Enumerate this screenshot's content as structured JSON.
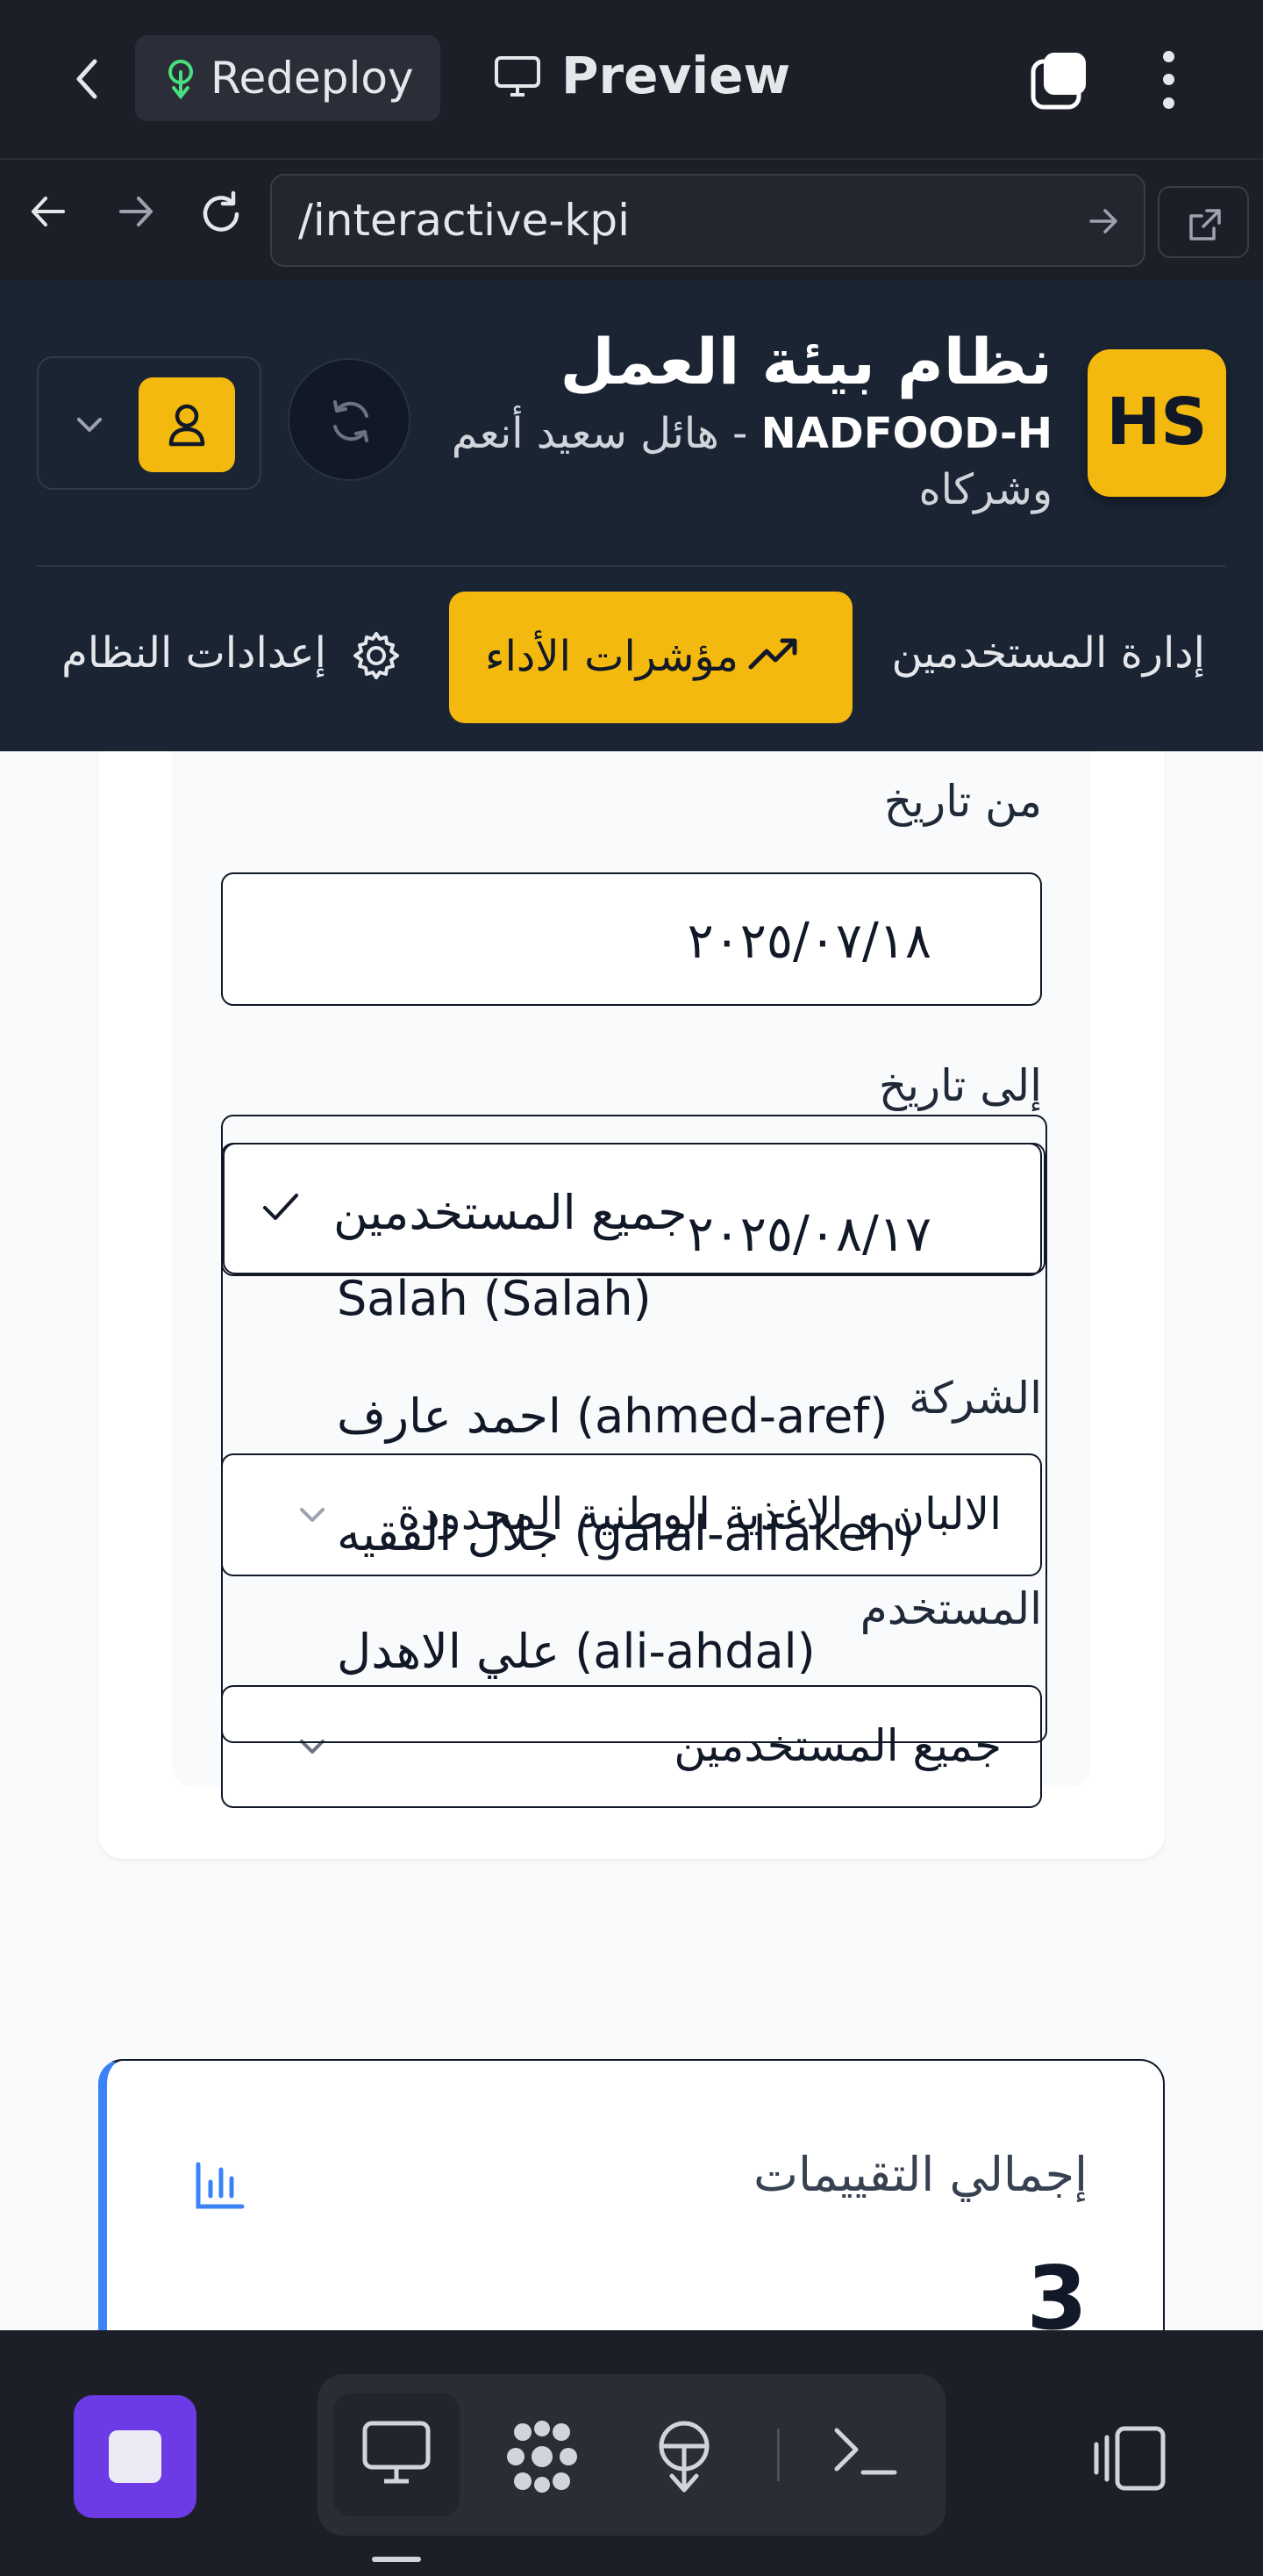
{
  "toolbar": {
    "redeploy_label": "Redeploy",
    "preview_label": "Preview"
  },
  "browser": {
    "url": "/interactive-kpi"
  },
  "app_header": {
    "logo_text": "HS",
    "title": "نظام بيئة العمل",
    "company_code": "NADFOOD-H",
    "company_name_line1": " - هائل سعيد أنعم",
    "company_name_line2": "وشركاه"
  },
  "nav": {
    "users": "إدارة المستخدمين",
    "kpi": "مؤشرات الأداء",
    "settings": "إعدادات النظام"
  },
  "filters": {
    "from_date_label": "من تاريخ",
    "from_date_value": "٢٠٢٥/٠٧/١٨",
    "to_date_label": "إلى تاريخ",
    "to_date_value": "٢٠٢٥/٠٨/١٧",
    "company_label": "الشركة",
    "company_value": "الالبان و الاغذية الوطنية المحدودة",
    "user_label": "المستخدم",
    "user_value": "جميع المستخدمين"
  },
  "user_dropdown": {
    "options": [
      {
        "label": "جميع المستخدمين",
        "selected": true
      },
      {
        "label": "Salah (Salah)",
        "selected": false
      },
      {
        "label": "احمد عارف (ahmed-aref)",
        "selected": false
      },
      {
        "label": "جلال الفقيه (galal-alfakeh)",
        "selected": false
      },
      {
        "label": "علي الاهدل (ali-ahdal)",
        "selected": false
      }
    ]
  },
  "stats": {
    "total_ratings_label": "إجمالي التقييمات",
    "total_ratings_value": "3",
    "accent_color": "#3b82f6"
  },
  "colors": {
    "brand_yellow": "#f4b90f",
    "header_bg": "#1a2433",
    "stop_purple": "#6c3be6"
  }
}
